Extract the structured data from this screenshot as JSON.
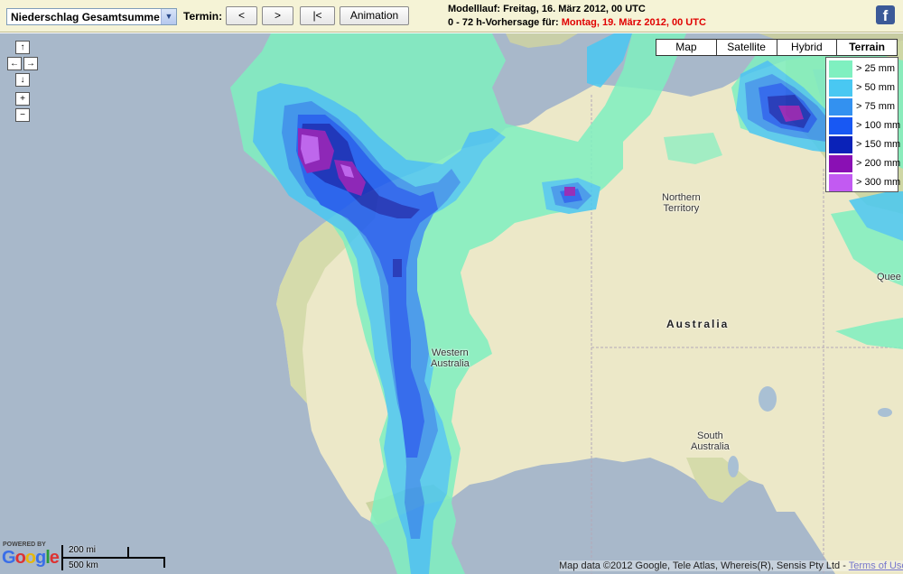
{
  "toolbar": {
    "product_select": "Niederschlag Gesamtsumme",
    "termin_label": "Termin:",
    "prev_label": "<",
    "next_label": ">",
    "first_label": "|<",
    "animation_label": "Animation",
    "model_run": "Modelllauf: Freitag, 16. März 2012, 00 UTC",
    "forecast_prefix": "0 - 72 h-Vorhersage für:",
    "forecast_date": "Montag, 19. März 2012, 00 UTC",
    "facebook": "f"
  },
  "navigation": {
    "up": "↑",
    "left": "←",
    "right": "→",
    "down": "↓",
    "zoom_in": "+",
    "zoom_out": "−"
  },
  "map_types": [
    {
      "label": "Map",
      "active": false
    },
    {
      "label": "Satellite",
      "active": false
    },
    {
      "label": "Hybrid",
      "active": false
    },
    {
      "label": "Terrain",
      "active": true
    }
  ],
  "legend": [
    {
      "label": "> 25 mm",
      "color": "#7ff0c0"
    },
    {
      "label": "> 50 mm",
      "color": "#49c8f2"
    },
    {
      "label": "> 75 mm",
      "color": "#3391f0"
    },
    {
      "label": "> 100 mm",
      "color": "#1858f3"
    },
    {
      "label": "> 150 mm",
      "color": "#0a22b8"
    },
    {
      "label": "> 200 mm",
      "color": "#8a10b4"
    },
    {
      "label": "> 300 mm",
      "color": "#c25af2"
    }
  ],
  "map_labels": {
    "northern_territory": "Northern\nTerritory",
    "australia": "Australia",
    "western_australia": "Western\nAustralia",
    "south_australia": "South\nAustralia",
    "queensland": "Quee"
  },
  "footer": {
    "powered_by": "POWERED BY",
    "google": "Google",
    "scale_mi": "200 mi",
    "scale_km": "500 km",
    "copyright": "Map data ©2012 Google, Tele Atlas, Whereis(R), Sensis Pty Ltd - ",
    "terms": "Terms of Use"
  }
}
